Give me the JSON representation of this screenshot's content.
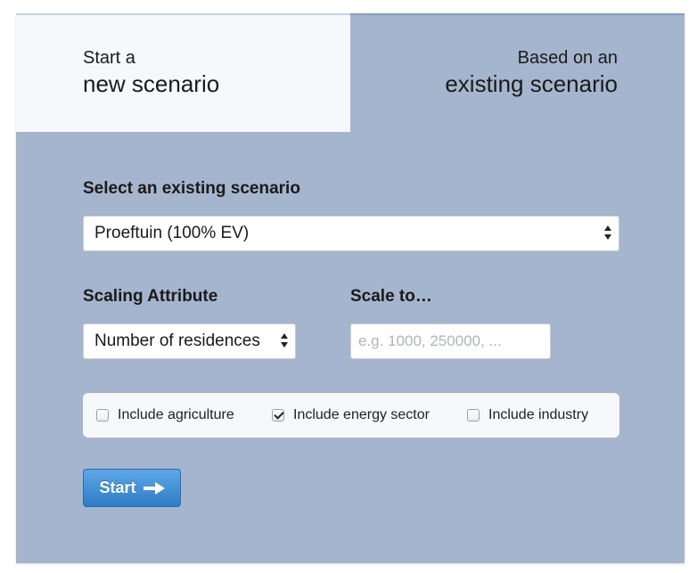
{
  "tabs": {
    "new": {
      "line1": "Start a",
      "line2": "new scenario"
    },
    "existing": {
      "line1": "Based on an",
      "line2": "existing scenario"
    }
  },
  "form": {
    "existing_scenario_label": "Select an existing scenario",
    "existing_scenario_value": "Proeftuin (100% EV)",
    "scaling_attribute_label": "Scaling Attribute",
    "scaling_attribute_value": "Number of residences",
    "scale_to_label": "Scale to…",
    "scale_to_placeholder": "e.g. 1000, 250000, ...",
    "scale_to_value": ""
  },
  "checkboxes": [
    {
      "label": "Include agriculture",
      "checked": false
    },
    {
      "label": "Include energy sector",
      "checked": true
    },
    {
      "label": "Include industry",
      "checked": false
    }
  ],
  "start_button": {
    "label": "Start",
    "icon": "arrow-right-icon"
  },
  "colors": {
    "panel": "#a5b5ce",
    "active_tab": "#f7f8fa",
    "button": "#3b88d2"
  }
}
